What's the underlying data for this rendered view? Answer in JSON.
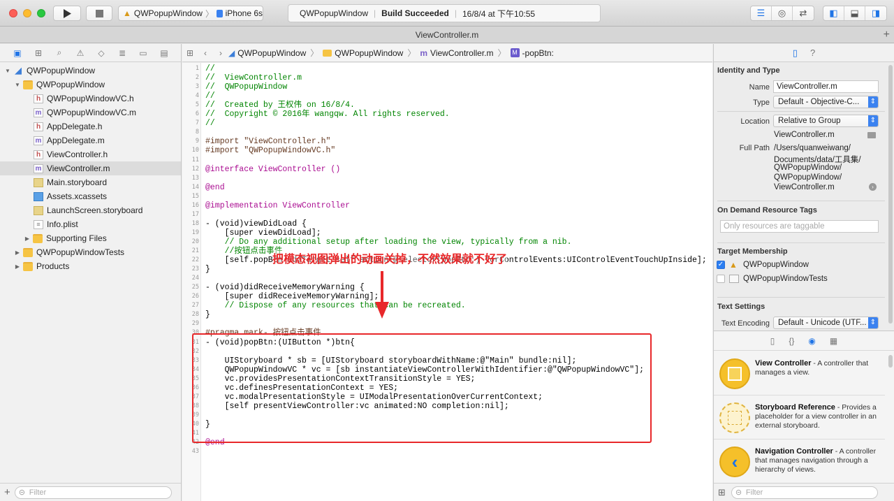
{
  "toolbar": {
    "scheme_project": "QWPopupWindow",
    "scheme_device": "iPhone 6s",
    "activity_project": "QWPopupWindow",
    "activity_status": "Build Succeeded",
    "activity_time": "16/8/4 at 下午10:55"
  },
  "tab": {
    "title": "ViewController.m",
    "add_label": "+"
  },
  "navigator": {
    "items": [
      {
        "label": "QWPopupWindow"
      },
      {
        "label": "QWPopupWindow"
      },
      {
        "label": "QWPopupWindowVC.h"
      },
      {
        "label": "QWPopupWindowVC.m"
      },
      {
        "label": "AppDelegate.h"
      },
      {
        "label": "AppDelegate.m"
      },
      {
        "label": "ViewController.h"
      },
      {
        "label": "ViewController.m"
      },
      {
        "label": "Main.storyboard"
      },
      {
        "label": "Assets.xcassets"
      },
      {
        "label": "LaunchScreen.storyboard"
      },
      {
        "label": "Info.plist"
      },
      {
        "label": "Supporting Files"
      },
      {
        "label": "QWPopupWindowTests"
      },
      {
        "label": "Products"
      }
    ],
    "filter_placeholder": "Filter"
  },
  "jumpbar": {
    "crumbs": [
      "QWPopupWindow",
      "QWPopupWindow",
      "ViewController.m",
      "-popBtn:"
    ]
  },
  "editor": {
    "line_numbers": [
      "1",
      "2",
      "3",
      "4",
      "5",
      "6",
      "7",
      "8",
      "9",
      "10",
      "11",
      "12",
      "13",
      "14",
      "15",
      "16",
      "17",
      "18",
      "19",
      "20",
      "21",
      "22",
      "23",
      "24",
      "25",
      "26",
      "27",
      "28",
      "29",
      "30",
      "31",
      "32",
      "33",
      "34",
      "35",
      "36",
      "37",
      "38",
      "39",
      "40",
      "41",
      "42",
      "43"
    ],
    "lines": [
      "//",
      "//  ViewController.m",
      "//  QWPopupWindow",
      "//",
      "//  Created by 王权伟 on 16/8/4.",
      "//  Copyright © 2016年 wangqw. All rights reserved.",
      "//",
      "",
      "#import \"ViewController.h\"",
      "#import \"QWPopupWindowVC.h\"",
      "",
      "@interface ViewController ()",
      "",
      "@end",
      "",
      "@implementation ViewController",
      "",
      "- (void)viewDidLoad {",
      "    [super viewDidLoad];",
      "    // Do any additional setup after loading the view, typically from a nib.",
      "    //按钮点击事件",
      "    [self.popBtn addTarget:self action:@selector(popBtn:) forControlEvents:UIControlEventTouchUpInside];",
      "}",
      "",
      "- (void)didReceiveMemoryWarning {",
      "    [super didReceiveMemoryWarning];",
      "    // Dispose of any resources that can be recreated.",
      "}",
      "",
      "#pragma mark- 按钮点击事件",
      "- (void)popBtn:(UIButton *)btn{",
      "",
      "    UIStoryboard * sb = [UIStoryboard storyboardWithName:@\"Main\" bundle:nil];",
      "    QWPopupWindowVC * vc = [sb instantiateViewControllerWithIdentifier:@\"QWPopupWindowVC\"];",
      "    vc.providesPresentationContextTransitionStyle = YES;",
      "    vc.definesPresentationContext = YES;",
      "    vc.modalPresentationStyle = UIModalPresentationOverCurrentContext;",
      "    [self presentViewController:vc animated:NO completion:nil];",
      "",
      "}",
      "",
      "@end",
      ""
    ],
    "annotation": "把模态视图弹出的动画关掉，不然效果就不好了"
  },
  "inspector": {
    "identity_title": "Identity and Type",
    "name_label": "Name",
    "name_value": "ViewController.m",
    "type_label": "Type",
    "type_value": "Default - Objective-C...",
    "location_label": "Location",
    "location_value": "Relative to Group",
    "location_file": "ViewController.m",
    "fullpath_label": "Full Path",
    "fullpath_lines": [
      "/Users/quanweiwang/",
      "Documents/data/工具集/",
      "QWPopupWindow/",
      "QWPopupWindow/",
      "ViewController.m"
    ],
    "ondemand_title": "On Demand Resource Tags",
    "ondemand_placeholder": "Only resources are taggable",
    "target_title": "Target Membership",
    "targets": [
      {
        "label": "QWPopupWindow",
        "checked": true
      },
      {
        "label": "QWPopupWindowTests",
        "checked": false
      }
    ],
    "text_settings_title": "Text Settings",
    "encoding_label": "Text Encoding",
    "encoding_value": "Default - Unicode (UTF..."
  },
  "library": {
    "items": [
      {
        "title": "View Controller",
        "desc": " - A controller that manages a view."
      },
      {
        "title": "Storyboard Reference",
        "desc": " - Provides a placeholder for a view controller in an external storyboard."
      },
      {
        "title": "Navigation Controller",
        "desc": " - A controller that manages navigation through a hierarchy of views."
      }
    ],
    "filter_placeholder": "Filter"
  }
}
